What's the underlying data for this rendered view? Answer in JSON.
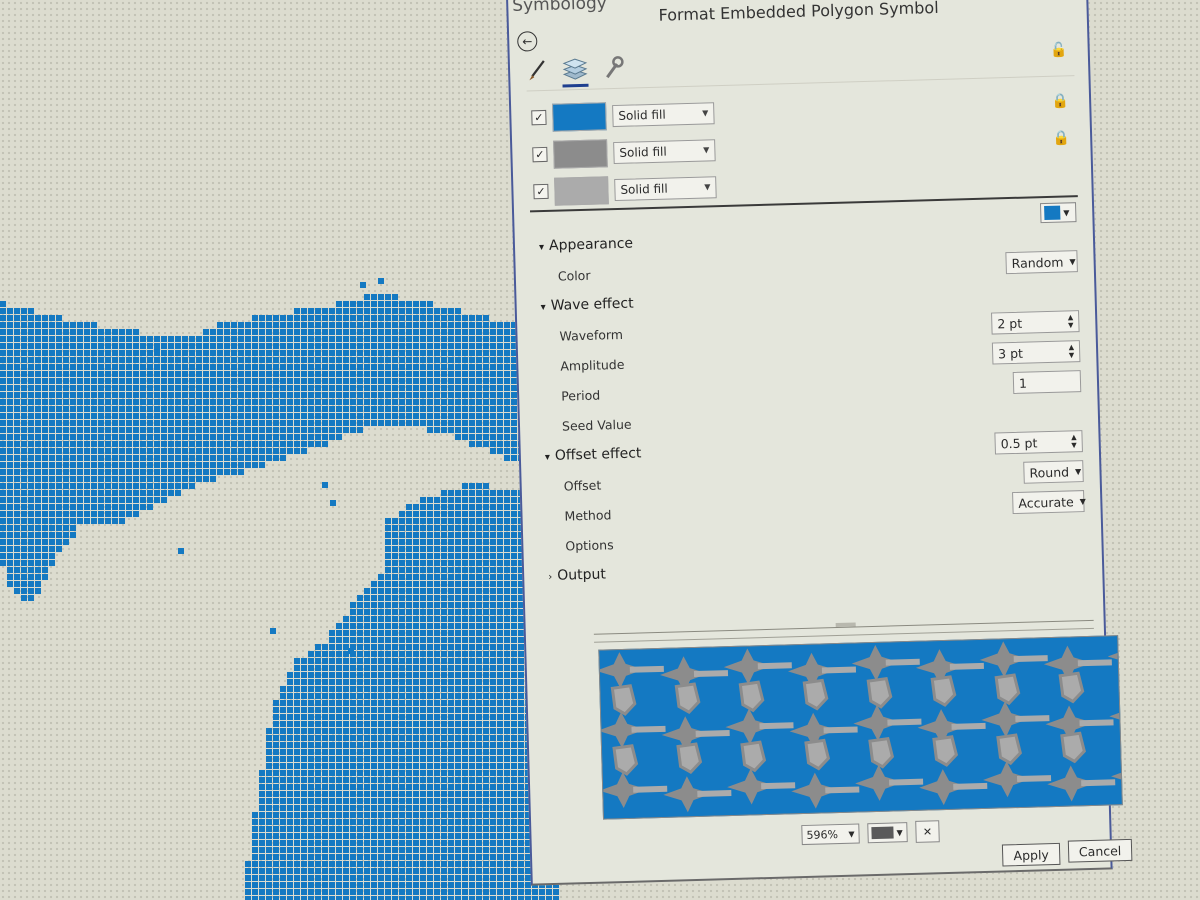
{
  "pane": {
    "title": "Symbology",
    "subtitle": "Format Embedded Polygon Symbol",
    "back_icon": "back-arrow-icon",
    "tabs": [
      {
        "name": "properties",
        "icon": "paintbrush-icon",
        "glyph": "╱",
        "active": false
      },
      {
        "name": "layers",
        "icon": "layers-icon",
        "glyph": "❖",
        "active": true
      },
      {
        "name": "structure",
        "icon": "wrench-icon",
        "glyph": "🔧",
        "active": false
      }
    ],
    "lock_icon": "color-lock-icon"
  },
  "layers": [
    {
      "checked": true,
      "check_glyph": "✓",
      "swatch_color": "#1479c2",
      "fill_type": "Solid fill",
      "locked": false
    },
    {
      "checked": true,
      "check_glyph": "✓",
      "swatch_color": "#8c8c8c",
      "fill_type": "Solid fill",
      "locked": true
    },
    {
      "checked": true,
      "check_glyph": "✓",
      "swatch_color": "#ababab",
      "fill_type": "Solid fill",
      "locked": true
    }
  ],
  "layer_color": "#1479c2",
  "properties": {
    "appearance": {
      "label": "Appearance",
      "expanded": true
    },
    "color": {
      "label": "Color",
      "value": "Random"
    },
    "wave_effect": {
      "label": "Wave effect",
      "expanded": true
    },
    "waveform": {
      "label": "Waveform",
      "value": "2 pt"
    },
    "amplitude": {
      "label": "Amplitude",
      "value": "3 pt"
    },
    "period": {
      "label": "Period",
      "value": "1"
    },
    "seed_value": {
      "label": "Seed Value"
    },
    "offset_effect": {
      "label": "Offset effect",
      "expanded": true,
      "value": "0.5 pt"
    },
    "offset": {
      "label": "Offset",
      "value": "Round"
    },
    "method": {
      "label": "Method",
      "value": "Accurate"
    },
    "options": {
      "label": "Options"
    },
    "output": {
      "label": "Output",
      "expanded": false
    }
  },
  "preview": {
    "zoom": "596%",
    "background_color": "#5a5a5a",
    "clear_glyph": "✕"
  },
  "buttons": {
    "apply": "Apply",
    "cancel": "Cancel"
  },
  "colors": {
    "water": "#1479c2",
    "land": "#dcdccf",
    "accent": "#1f3f8f"
  },
  "glyphs": {
    "chev_down": "▾",
    "chev_right": "›",
    "caret": "▼",
    "spin_up": "▲",
    "spin_down": "▼",
    "back": "←",
    "lock": "🔒",
    "lock_open": "🔓",
    "cursor": "↖"
  }
}
